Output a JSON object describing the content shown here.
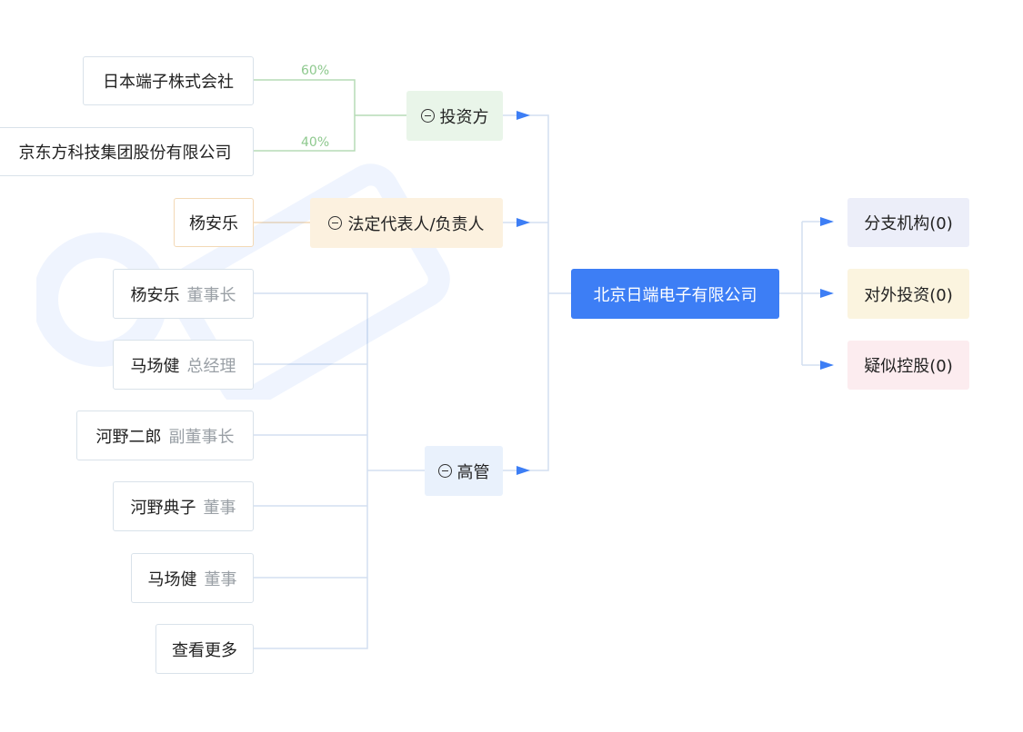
{
  "investors": {
    "label": "投资方",
    "items": [
      {
        "name": "日本端子株式会社",
        "pct": "60%"
      },
      {
        "name": "京东方科技集团股份有限公司",
        "pct": "40%"
      }
    ]
  },
  "legal_rep": {
    "label": "法定代表人/负责人",
    "name": "杨安乐"
  },
  "executives": {
    "label": "高管",
    "items": [
      {
        "name": "杨安乐",
        "role": "董事长"
      },
      {
        "name": "马场健",
        "role": "总经理"
      },
      {
        "name": "河野二郎",
        "role": "副董事长"
      },
      {
        "name": "河野典子",
        "role": "董事"
      },
      {
        "name": "马场健",
        "role": "董事"
      }
    ],
    "more": "查看更多"
  },
  "company": {
    "name": "北京日端电子有限公司"
  },
  "right": [
    {
      "label": "分支机构(0)",
      "bg": "#eceef9"
    },
    {
      "label": "对外投资(0)",
      "bg": "#fbf4df"
    },
    {
      "label": "疑似控股(0)",
      "bg": "#fcecef"
    }
  ],
  "colors": {
    "accent": "#3d7ef5",
    "investor_bg": "#e9f5e9",
    "legal_bg": "#fcf1df",
    "exec_bg": "#e9f1fc"
  }
}
